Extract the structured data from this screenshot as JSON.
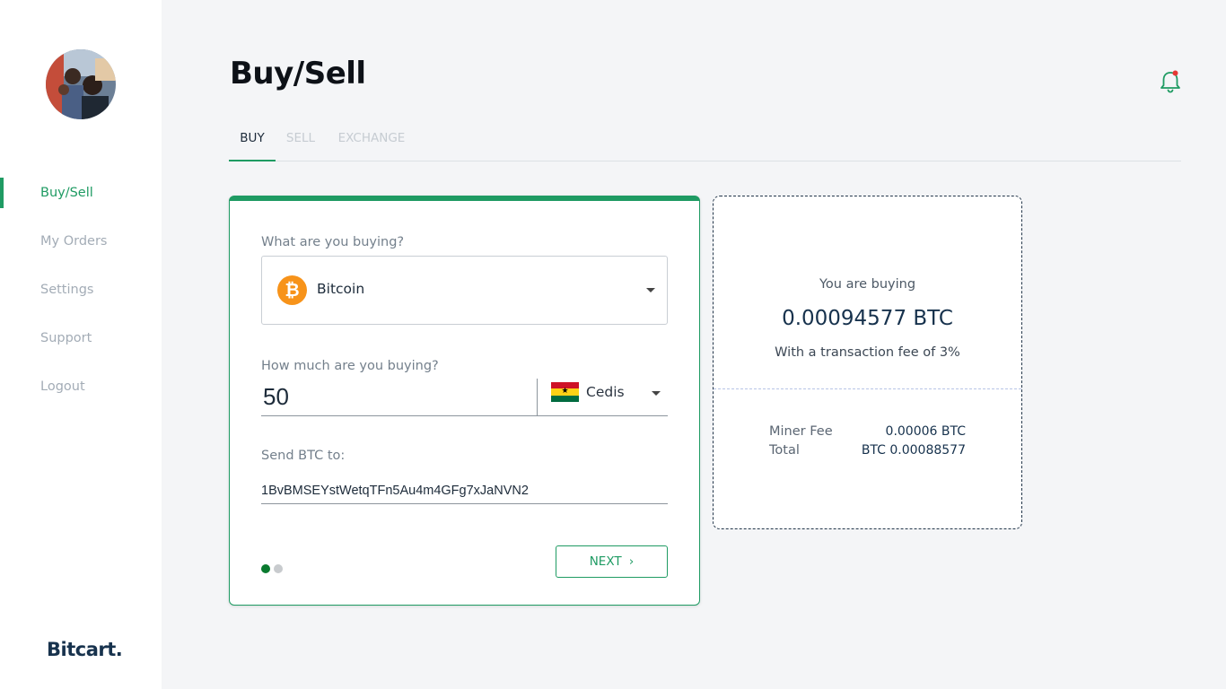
{
  "sidebar": {
    "nav": [
      {
        "label": "Buy/Sell",
        "active": true
      },
      {
        "label": "My Orders",
        "active": false
      },
      {
        "label": "Settings",
        "active": false
      },
      {
        "label": "Support",
        "active": false
      },
      {
        "label": "Logout",
        "active": false
      }
    ],
    "brand": "Bitcart."
  },
  "header": {
    "title": "Buy/Sell",
    "notification_icon": "bell-icon"
  },
  "tabs": [
    {
      "label": "BUY",
      "active": true
    },
    {
      "label": "SELL",
      "active": false
    },
    {
      "label": "EXCHANGE",
      "active": false
    }
  ],
  "buy_form": {
    "asset_label": "What are you buying?",
    "asset_selected": "Bitcoin",
    "asset_icon": "bitcoin-icon",
    "amount_label": "How much are you buying?",
    "amount_value": "50",
    "currency_selected": "Cedis",
    "currency_icon": "ghana-flag-icon",
    "address_label": "Send BTC to:",
    "address_value": "1BvBMSEYstWetqTFn5Au4m4GFg7xJaNVN2",
    "next_label": "NEXT",
    "step": {
      "current": 1,
      "total": 2
    }
  },
  "summary": {
    "buying_label": "You are buying",
    "buying_amount": "0.00094577 BTC",
    "fee_text": "With a transaction fee of 3%",
    "rows": [
      {
        "label": "Miner Fee",
        "value": "0.00006 BTC"
      },
      {
        "label": "Total",
        "value": "BTC 0.00088577"
      }
    ]
  },
  "colors": {
    "accent": "#1f9b63",
    "notification_dot": "#e53935",
    "bitcoin": "#f7931a"
  }
}
